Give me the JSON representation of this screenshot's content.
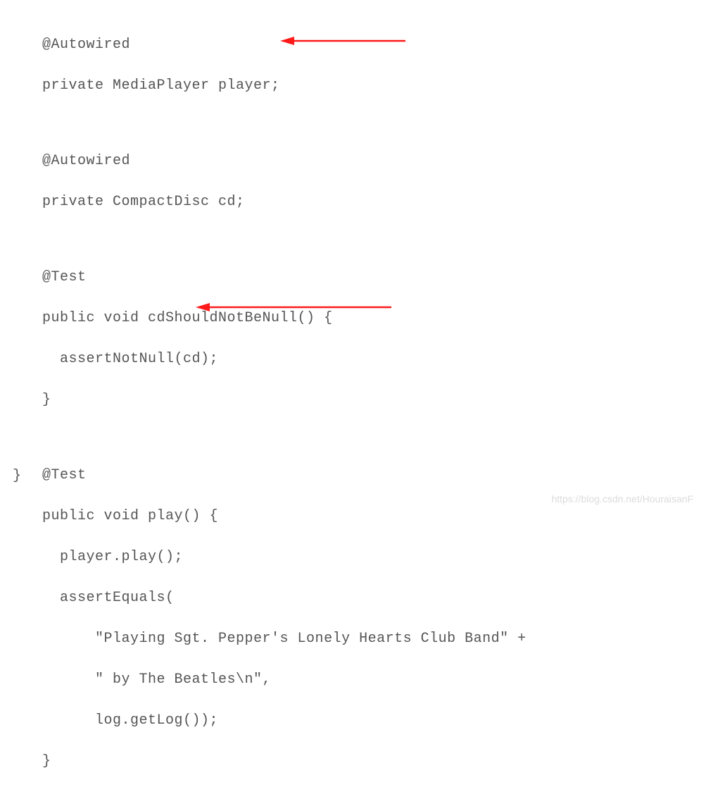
{
  "code": {
    "lines": [
      "@Autowired",
      "private MediaPlayer player;",
      "",
      "@Autowired",
      "private CompactDisc cd;",
      "",
      "@Test",
      "public void cdShouldNotBeNull() {",
      "  assertNotNull(cd);",
      "}",
      "",
      "@Test",
      "public void play() {",
      "  player.play();",
      "  assertEquals(",
      "      \"Playing Sgt. Pepper's Lonely Hearts Club Band\" +",
      "      \" by The Beatles\\n\",",
      "      log.getLog());",
      "}",
      "",
      "}"
    ],
    "closing_brace": "}"
  },
  "annotations": {
    "arrow1": {
      "points_to": "private MediaPlayer player;"
    },
    "arrow2": {
      "points_to": "player.play();"
    }
  },
  "watermark": "https://blog.csdn.net/HouraisanF"
}
